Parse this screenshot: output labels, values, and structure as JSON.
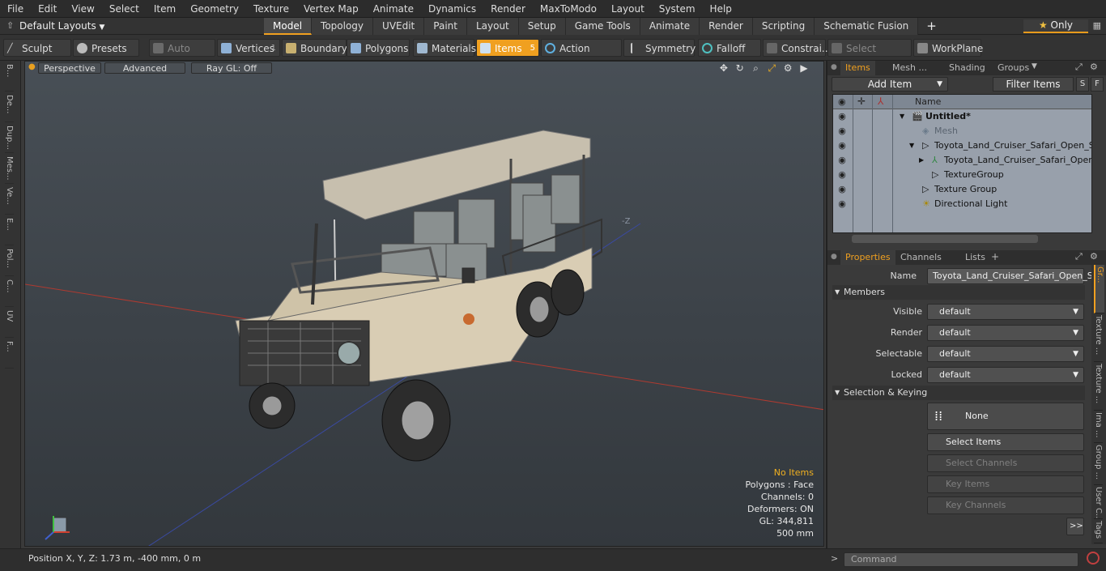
{
  "menu": [
    "File",
    "Edit",
    "View",
    "Select",
    "Item",
    "Geometry",
    "Texture",
    "Vertex Map",
    "Animate",
    "Dynamics",
    "Render",
    "MaxToModo",
    "Layout",
    "System",
    "Help"
  ],
  "layout_selector": "Default Layouts",
  "mode_tabs": [
    "Model",
    "Topology",
    "UVEdit",
    "Paint",
    "Layout",
    "Setup",
    "Game Tools",
    "Animate",
    "Render",
    "Scripting",
    "Schematic Fusion"
  ],
  "active_mode_tab": "Model",
  "only_button": "Only",
  "toolbar": {
    "sculpt": "Sculpt",
    "presets": "Presets",
    "auto_select": "Auto Select",
    "vertices": "Vertices",
    "vertices_count": "1",
    "boundary": "Boundary",
    "polygons": "Polygons",
    "materials": "Materials",
    "items": "Items",
    "items_count": "5",
    "action_center": "Action Center",
    "symmetry": "Symmetry",
    "falloff": "Falloff",
    "constraints": "Constrai...",
    "select_through": "Select Through",
    "workplane": "WorkPlane"
  },
  "left_tabs": [
    "B...",
    "De...",
    "Dup...",
    "Mes...",
    "Ve...",
    "E...",
    "Pol...",
    "C...",
    "UV",
    "F..."
  ],
  "viewport": {
    "view_mode": "Perspective",
    "shading": "Advanced",
    "raygl": "Ray GL: Off",
    "stats": {
      "selection": "No Items",
      "polygons": "Polygons : Face",
      "channels": "Channels: 0",
      "deformers": "Deformers: ON",
      "gl": "GL: 344,811",
      "unit": "500 mm"
    },
    "axis_label": "-Z"
  },
  "status_position": "Position X, Y, Z:   1.73 m, -400 mm, 0 m",
  "items_panel": {
    "tabs": [
      "Items",
      "Mesh ...",
      "Shading",
      "Groups"
    ],
    "add_item": "Add Item",
    "filter_items": "Filter Items",
    "btn_s": "S",
    "btn_f": "F",
    "name_header": "Name",
    "rows": [
      {
        "label": "Untitled*",
        "indent": 0,
        "bold": true
      },
      {
        "label": "Mesh",
        "indent": 1,
        "dim": true
      },
      {
        "label": "Toyota_Land_Cruiser_Safari_Open_S...",
        "indent": 1
      },
      {
        "label": "Toyota_Land_Cruiser_Safari_Open...",
        "indent": 2
      },
      {
        "label": "TextureGroup",
        "indent": 2
      },
      {
        "label": "Texture Group",
        "indent": 1
      },
      {
        "label": "Directional Light",
        "indent": 1
      }
    ]
  },
  "properties_panel": {
    "tabs": [
      "Properties",
      "Channels",
      "Lists"
    ],
    "name_label": "Name",
    "name_value": "Toyota_Land_Cruiser_Safari_Open_Si",
    "members_header": "Members",
    "visible_label": "Visible",
    "visible_value": "default",
    "render_label": "Render",
    "render_value": "default",
    "selectable_label": "Selectable",
    "selectable_value": "default",
    "locked_label": "Locked",
    "locked_value": "default",
    "selkey_header": "Selection & Keying",
    "none_label": "None",
    "select_items": "Select Items",
    "select_channels": "Select Channels",
    "key_items": "Key Items",
    "key_channels": "Key Channels",
    "more": ">>"
  },
  "right_vtabs": [
    "Gr...",
    "Texture ...",
    "Texture ...",
    "Ima ...",
    "Group ...",
    "User C...",
    "Tags"
  ],
  "command_placeholder": "Command"
}
